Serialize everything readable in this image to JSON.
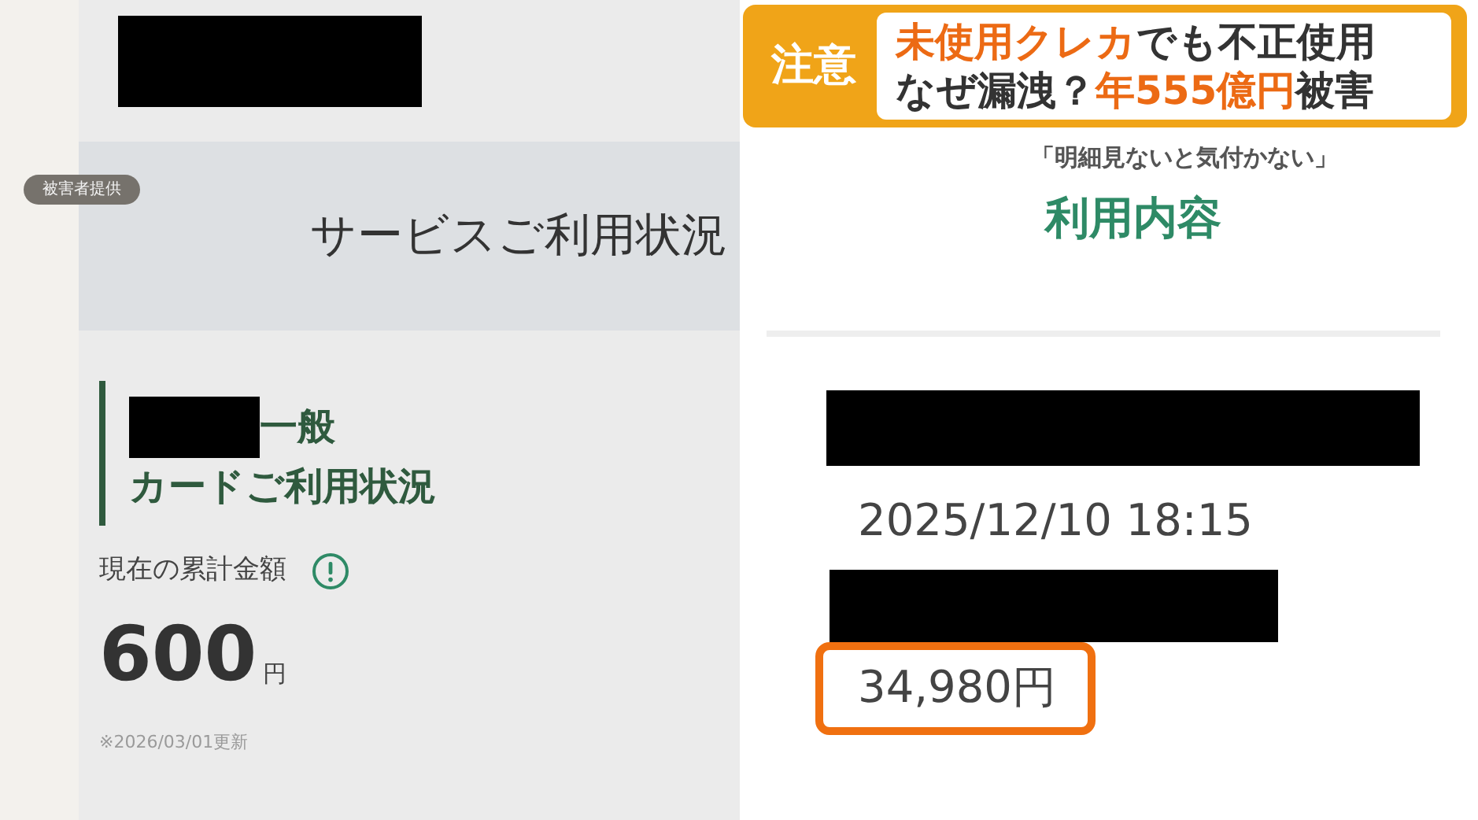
{
  "left_screen": {
    "section_title": "サービスご利用状況",
    "card_name_suffix": "一般",
    "card_title": "カードご利用状況",
    "total_label": "現在の累計金額",
    "total_amount": "600",
    "currency": "円",
    "updated_note": "※2026/03/01更新"
  },
  "right_screen": {
    "title": "利用内容",
    "datetime": "2025/12/10 18:15",
    "amount": "34,980円",
    "amount_highlighted": true
  },
  "overlay": {
    "credit_badge": "被害者提供",
    "caption_tag": "注意",
    "caption_lines": [
      [
        {
          "text": "未使用クレカ",
          "highlight": true
        },
        {
          "text": "でも不正使用",
          "highlight": false
        }
      ],
      [
        {
          "text": "なぜ漏洩？",
          "highlight": false
        },
        {
          "text": "年555億円",
          "highlight": true
        },
        {
          "text": "被害",
          "highlight": false
        }
      ]
    ],
    "subtitle": "「明細見ないと気付かない」"
  }
}
